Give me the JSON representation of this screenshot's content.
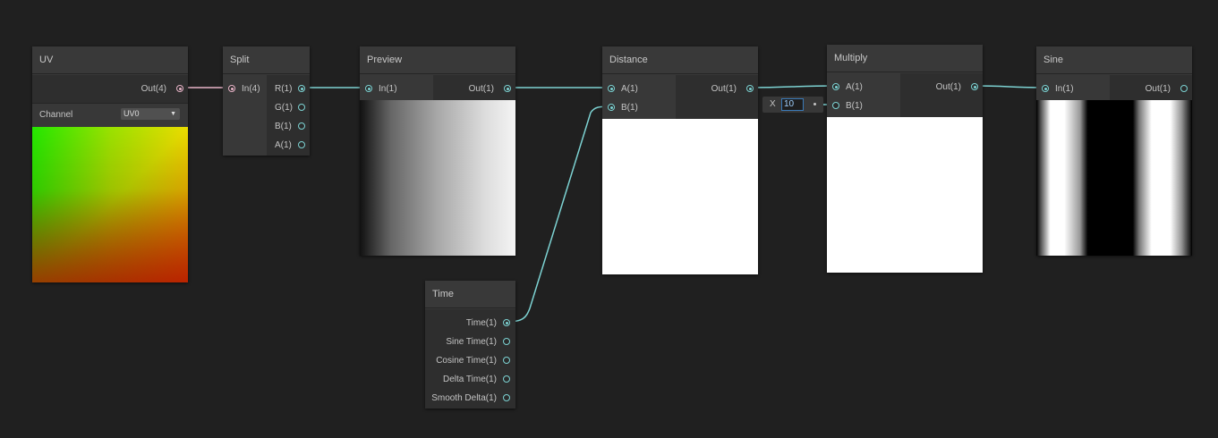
{
  "colors": {
    "background": "#202020",
    "node_body": "#383838",
    "wire_float": "#7dd3d3",
    "wire_vector": "#e8b4c8"
  },
  "nodes": {
    "uv": {
      "title": "UV",
      "out_label": "Out(4)",
      "channel_label": "Channel",
      "channel_value": "UV0"
    },
    "split": {
      "title": "Split",
      "in_label": "In(4)",
      "outputs": [
        "R(1)",
        "G(1)",
        "B(1)",
        "A(1)"
      ]
    },
    "preview": {
      "title": "Preview",
      "in_label": "In(1)",
      "out_label": "Out(1)"
    },
    "time": {
      "title": "Time",
      "outputs": [
        "Time(1)",
        "Sine Time(1)",
        "Cosine Time(1)",
        "Delta Time(1)",
        "Smooth Delta(1)"
      ]
    },
    "distance": {
      "title": "Distance",
      "inputs": [
        "A(1)",
        "B(1)"
      ],
      "out_label": "Out(1)"
    },
    "multiply": {
      "title": "Multiply",
      "inputs": [
        "A(1)",
        "B(1)"
      ],
      "out_label": "Out(1)",
      "b_field_axis": "X",
      "b_field_value": "10"
    },
    "sine": {
      "title": "Sine",
      "in_label": "In(1)",
      "out_label": "Out(1)"
    }
  }
}
